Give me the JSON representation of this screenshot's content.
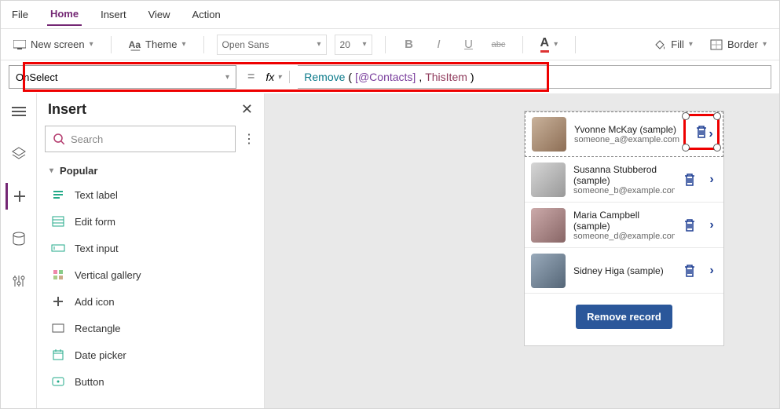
{
  "menu": {
    "items": [
      "File",
      "Home",
      "Insert",
      "View",
      "Action"
    ],
    "activeIndex": 1
  },
  "toolbar": {
    "newscreen": "New screen",
    "theme": "Theme",
    "font": "Open Sans",
    "size": "20",
    "bold": "B",
    "italic": "I",
    "underline": "U",
    "strike": "abc",
    "fontcolor": "A",
    "fill": "Fill",
    "border": "Border"
  },
  "formula": {
    "property": "OnSelect",
    "fn": "Remove",
    "open": "( ",
    "arg1": "[@Contacts]",
    "comma": ", ",
    "arg2": "ThisItem",
    "close": " )"
  },
  "insert": {
    "title": "Insert",
    "search_placeholder": "Search",
    "section": "Popular",
    "items": [
      {
        "label": "Text label",
        "icon": "text"
      },
      {
        "label": "Edit form",
        "icon": "form"
      },
      {
        "label": "Text input",
        "icon": "input"
      },
      {
        "label": "Vertical gallery",
        "icon": "gallery"
      },
      {
        "label": "Add icon",
        "icon": "plus"
      },
      {
        "label": "Rectangle",
        "icon": "rect"
      },
      {
        "label": "Date picker",
        "icon": "date"
      },
      {
        "label": "Button",
        "icon": "button"
      }
    ]
  },
  "contacts": [
    {
      "name": "Yvonne McKay (sample)",
      "email": "someone_a@example.com",
      "selected": true
    },
    {
      "name": "Susanna Stubberod (sample)",
      "email": "someone_b@example.com"
    },
    {
      "name": "Maria Campbell (sample)",
      "email": "someone_d@example.com"
    },
    {
      "name": "Sidney Higa (sample)",
      "email": ""
    }
  ],
  "remove_label": "Remove record"
}
